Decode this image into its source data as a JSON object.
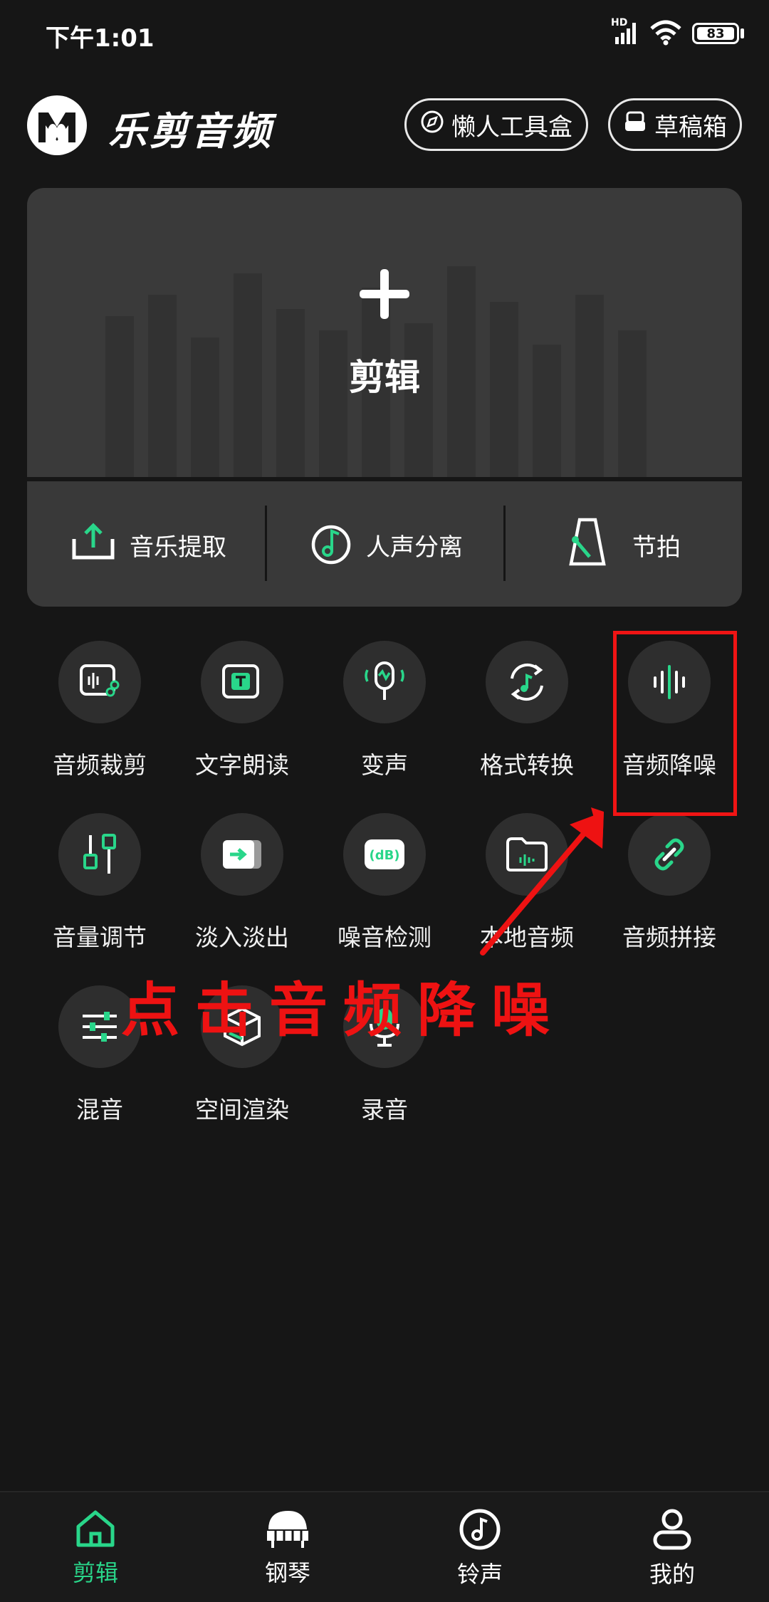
{
  "status_bar": {
    "time": "下午1:01",
    "network": "HD",
    "battery": "83"
  },
  "header": {
    "app_name": "乐剪音频",
    "toolbox_label": "懒人工具盒",
    "drafts_label": "草稿箱"
  },
  "main_card": {
    "edit_label": "剪辑",
    "quick_actions": [
      {
        "label": "音乐提取",
        "icon": "upload-icon"
      },
      {
        "label": "人声分离",
        "icon": "music-note-icon"
      },
      {
        "label": "节拍",
        "icon": "metronome-icon"
      }
    ]
  },
  "tools": [
    {
      "label": "音频裁剪",
      "icon": "audio-cut-icon"
    },
    {
      "label": "文字朗读",
      "icon": "text-read-icon"
    },
    {
      "label": "变声",
      "icon": "voice-change-icon"
    },
    {
      "label": "格式转换",
      "icon": "format-convert-icon"
    },
    {
      "label": "音频降噪",
      "icon": "noise-reduce-icon"
    },
    {
      "label": "音量调节",
      "icon": "volume-adjust-icon"
    },
    {
      "label": "淡入淡出",
      "icon": "fade-icon"
    },
    {
      "label": "噪音检测",
      "icon": "db-meter-icon"
    },
    {
      "label": "本地音频",
      "icon": "folder-icon"
    },
    {
      "label": "音频拼接",
      "icon": "link-icon"
    },
    {
      "label": "混音",
      "icon": "mixer-icon"
    },
    {
      "label": "空间渲染",
      "icon": "cube-icon"
    },
    {
      "label": "录音",
      "icon": "microphone-icon"
    }
  ],
  "annotation": {
    "text": "点击音频降噪"
  },
  "nav": [
    {
      "label": "剪辑",
      "icon": "home-icon",
      "active": true
    },
    {
      "label": "钢琴",
      "icon": "piano-icon"
    },
    {
      "label": "铃声",
      "icon": "ringtone-icon"
    },
    {
      "label": "我的",
      "icon": "user-icon"
    }
  ],
  "colors": {
    "accent": "#29d68a",
    "background": "#161616",
    "annotation": "#ee1212"
  }
}
